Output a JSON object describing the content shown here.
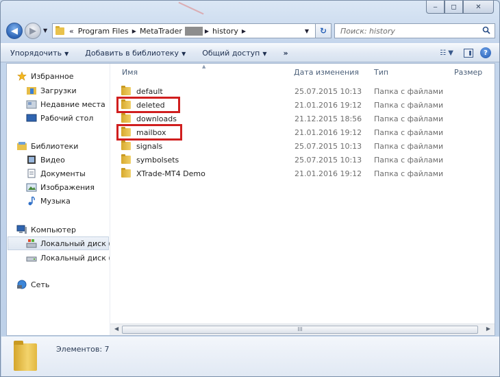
{
  "window": {
    "caption_buttons": {
      "minimize": "‒",
      "maximize": "◻",
      "close": "✕"
    }
  },
  "address": {
    "overflow": "«",
    "crumbs": [
      "Program Files",
      "MetaTrader",
      "history"
    ],
    "search_placeholder": "Поиск: history"
  },
  "toolbar": {
    "organize": "Упорядочить",
    "add_to_library": "Добавить в библиотеку",
    "share": "Общий доступ",
    "more": "»"
  },
  "nav": {
    "favorites": "Избранное",
    "downloads": "Загрузки",
    "recent": "Недавние места",
    "desktop": "Рабочий стол",
    "libraries": "Библиотеки",
    "video": "Видео",
    "documents": "Документы",
    "images": "Изображения",
    "music": "Музыка",
    "computer": "Компьютер",
    "disk_c": "Локальный диск (С",
    "disk_d": "Локальный диск (D",
    "network": "Сеть"
  },
  "columns": {
    "name": "Имя",
    "date": "Дата изменения",
    "type": "Тип",
    "size": "Размер"
  },
  "files": [
    {
      "name": "default",
      "date": "25.07.2015 10:13",
      "type": "Папка с файлами"
    },
    {
      "name": "deleted",
      "date": "21.01.2016 19:12",
      "type": "Папка с файлами"
    },
    {
      "name": "downloads",
      "date": "21.12.2015 18:56",
      "type": "Папка с файлами"
    },
    {
      "name": "mailbox",
      "date": "21.01.2016 19:12",
      "type": "Папка с файлами"
    },
    {
      "name": "signals",
      "date": "25.07.2015 10:13",
      "type": "Папка с файлами"
    },
    {
      "name": "symbolsets",
      "date": "25.07.2015 10:13",
      "type": "Папка с файлами"
    },
    {
      "name": "XTrade-MT4 Demo",
      "date": "21.01.2016 19:12",
      "type": "Папка с файлами"
    }
  ],
  "scrollbar_thumb_grip": "III",
  "status": {
    "items": "Элементов: 7"
  },
  "colors": {
    "highlight": "#d01e1e",
    "accent": "#2d64b5"
  }
}
